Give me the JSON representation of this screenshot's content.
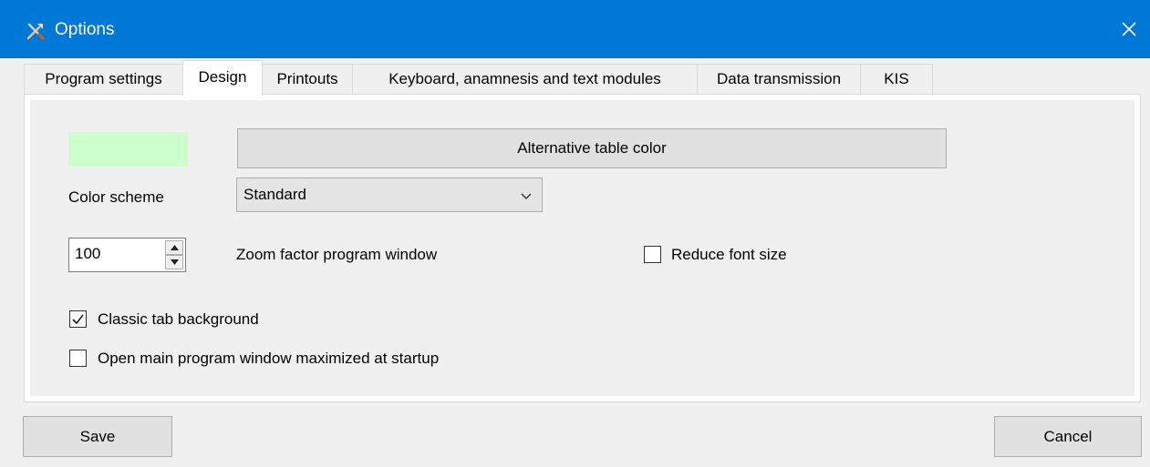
{
  "window": {
    "title": "Options",
    "icon": "tools-icon",
    "close_icon": "close-icon"
  },
  "tabs": [
    {
      "label": "Program settings",
      "active": false
    },
    {
      "label": "Design",
      "active": true
    },
    {
      "label": "Printouts",
      "active": false
    },
    {
      "label": "Keyboard, anamnesis and text modules",
      "active": false
    },
    {
      "label": "Data transmission",
      "active": false
    },
    {
      "label": "KIS",
      "active": false
    }
  ],
  "design": {
    "alt_table_color_swatch": "#ccffcc",
    "alt_table_color_button": "Alternative table color",
    "color_scheme_label": "Color scheme",
    "color_scheme_value": "Standard",
    "zoom_value": "100",
    "zoom_label": "Zoom factor program window",
    "reduce_font_label": "Reduce font size",
    "reduce_font_checked": false,
    "classic_tab_label": "Classic tab background",
    "classic_tab_checked": true,
    "open_maximized_label": "Open main program window maximized at startup",
    "open_maximized_checked": false
  },
  "footer": {
    "save_label": "Save",
    "cancel_label": "Cancel"
  },
  "colors": {
    "titlebar": "#0078d7",
    "swatch": "#ccffcc"
  }
}
